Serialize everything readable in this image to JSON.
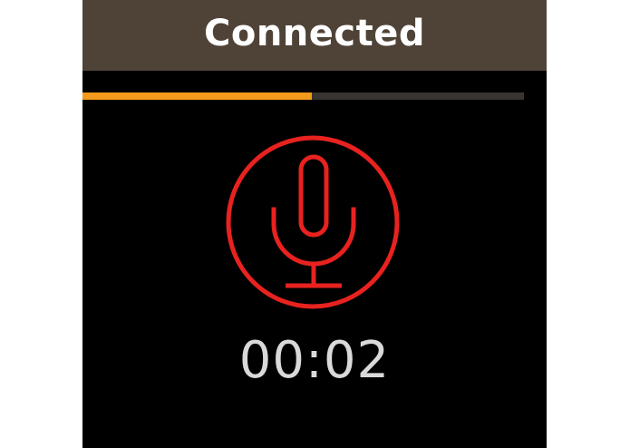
{
  "header": {
    "title": "Connected"
  },
  "progress": {
    "fraction": 0.52,
    "track_color": "#3a3430",
    "fill_color": "#f39a1c"
  },
  "recording": {
    "icon": "microphone-icon",
    "icon_color": "#e8221f",
    "elapsed": "00:02"
  }
}
